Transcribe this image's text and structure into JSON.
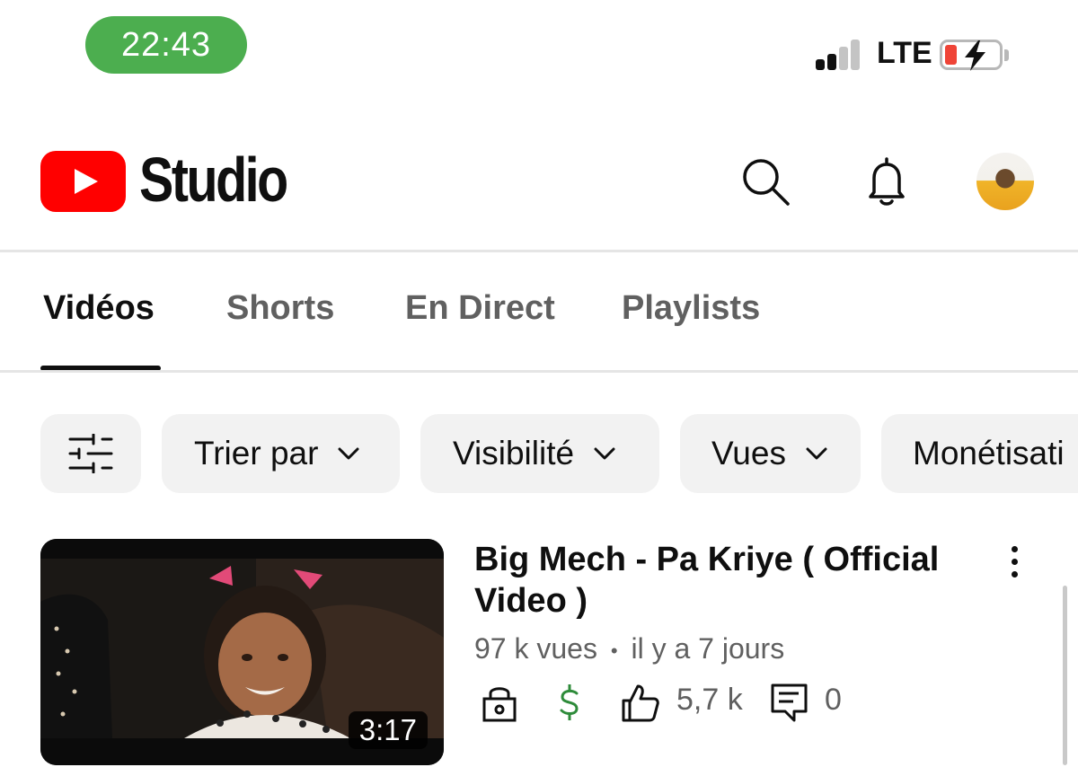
{
  "status_bar": {
    "time": "22:43",
    "network": "LTE",
    "time_pill_color": "#4cae4f",
    "battery_color": "#ef4437"
  },
  "header": {
    "logo_text": "Studio",
    "logo_color": "#ff0000",
    "icons": [
      "search-icon",
      "bell-icon",
      "avatar"
    ]
  },
  "tabs": [
    {
      "label": "Vidéos",
      "active": true
    },
    {
      "label": "Shorts",
      "active": false
    },
    {
      "label": "En Direct",
      "active": false
    },
    {
      "label": "Playlists",
      "active": false
    }
  ],
  "filters": {
    "icon": "filter-sliders-icon",
    "chips": [
      {
        "label": "Trier par"
      },
      {
        "label": "Visibilité"
      },
      {
        "label": "Vues"
      },
      {
        "label": "Monétisati"
      }
    ]
  },
  "video": {
    "title": "Big Mech -  Pa Kriye ( Official Video )",
    "views": "97 k vues",
    "separator": "•",
    "age": "il y a 7 jours",
    "duration": "3:17",
    "likes": "5,7 k",
    "comments": "0",
    "visibility_icon": "lock-icon",
    "monetization_icon": "dollar-icon",
    "monetization_color": "#2e8b3a"
  }
}
